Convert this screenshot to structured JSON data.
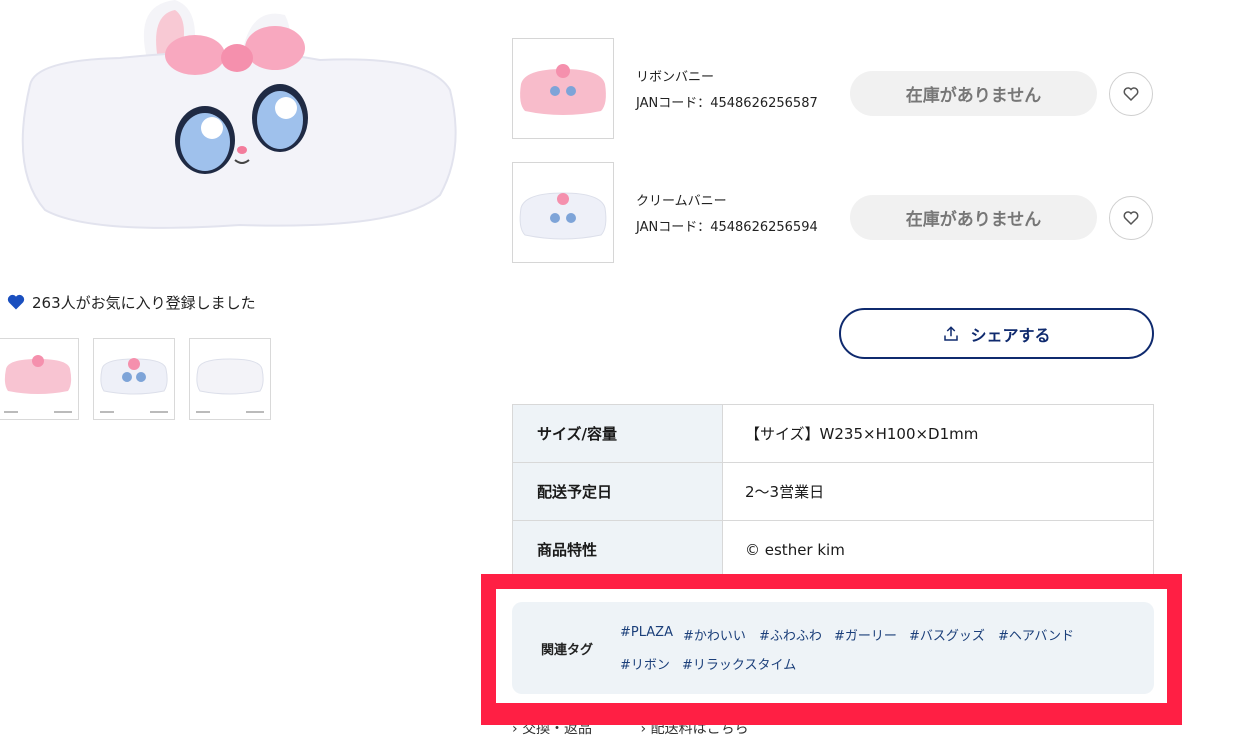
{
  "favorites": {
    "text": "263人がお気に入り登録しました",
    "icon": "heart-filled-icon",
    "color": "#1a4fbf"
  },
  "variants": [
    {
      "name": "リボンバニー",
      "jan": "JANコード：4548626256587",
      "stock": "在庫がありません",
      "color": "#f6b6c8"
    },
    {
      "name": "クリームバニー",
      "jan": "JANコード：4548626256594",
      "stock": "在庫がありません",
      "color": "#eef0f8"
    }
  ],
  "share": {
    "label": "シェアする",
    "icon": "share-upload-icon",
    "color": "#0f2a6e"
  },
  "specs": [
    {
      "key": "サイズ/容量",
      "value": "【サイズ】W235×H100×D1mm"
    },
    {
      "key": "配送予定日",
      "value": "2〜3営業日"
    },
    {
      "key": "商品特性",
      "value": "© esther kim"
    }
  ],
  "tags": {
    "label": "関連タグ",
    "items": [
      "#PLAZA",
      "#かわいい",
      "#ふわふわ",
      "#ガーリー",
      "#バスグッズ",
      "#ヘアバンド",
      "#リボン",
      "#リラックスタイム"
    ]
  },
  "highlight_color": "#ff1f44",
  "bottom_links": [
    "交換・返品",
    "配送料はこちら"
  ]
}
